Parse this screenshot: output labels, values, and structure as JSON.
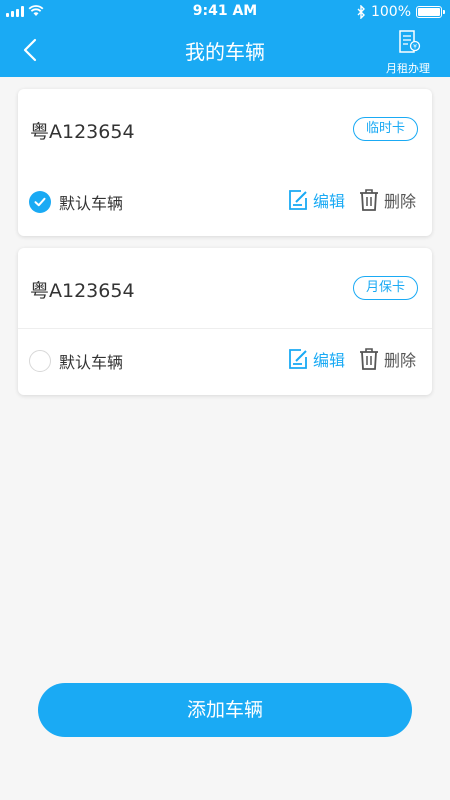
{
  "status_bar": {
    "time": "9:41 AM",
    "battery": "100%"
  },
  "nav": {
    "title": "我的车辆",
    "right_label": "月租办理"
  },
  "vehicles": [
    {
      "plate": "粤A123654",
      "tag": "临时卡",
      "default_label": "默认车辆",
      "is_default": true,
      "edit_label": "编辑",
      "delete_label": "删除"
    },
    {
      "plate": "粤A123654",
      "tag": "月保卡",
      "default_label": "默认车辆",
      "is_default": false,
      "edit_label": "编辑",
      "delete_label": "删除"
    }
  ],
  "add_button": "添加车辆",
  "colors": {
    "primary": "#1aaaf4",
    "background": "#f6f6f6"
  }
}
